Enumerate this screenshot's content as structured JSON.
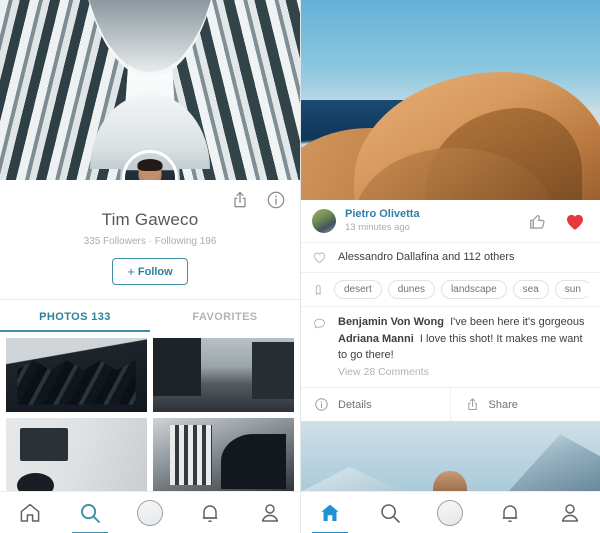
{
  "left": {
    "cover_image_alt": "curved-striped-building-cover",
    "avatar_alt": "user-avatar",
    "share_icon": "share-icon",
    "info_icon": "info-icon",
    "username": "Tim Gaweco",
    "stats": "335 Followers · Following 196",
    "follow_label": "Follow",
    "follow_plus": "+",
    "tabs": [
      {
        "label": "PHOTOS 133",
        "active": true
      },
      {
        "label": "FAVORITES",
        "active": false
      }
    ],
    "photos": [
      {
        "alt": "dark-geometric-architecture"
      },
      {
        "alt": "city-street-with-tower"
      },
      {
        "alt": "overhead-street-white"
      },
      {
        "alt": "spiral-parking-ramp"
      }
    ],
    "nav": [
      {
        "icon": "home-icon",
        "active": false
      },
      {
        "icon": "search-icon",
        "active": true
      },
      {
        "icon": "camera-circle-icon",
        "active": false
      },
      {
        "icon": "bell-icon",
        "active": false
      },
      {
        "icon": "profile-icon",
        "active": false
      }
    ]
  },
  "right": {
    "hero_alt": "desert-dunes-meeting-ocean",
    "post": {
      "avatar_alt": "pietro-olivetta-avatar",
      "user": "Pietro Olivetta",
      "time": "13 minutes ago",
      "thumb_icon": "thumbs-up-icon",
      "heart_icon": "heart-filled-icon",
      "likes_icon": "heart-outline-icon",
      "likes": "Alessandro Dallafina and 112 others",
      "tag_icon": "tag-icon",
      "tags": [
        "desert",
        "dunes",
        "landscape",
        "sea",
        "sun"
      ],
      "comment_icon": "comment-bubble-icon",
      "comments": [
        {
          "name": "Benjamin Von Wong",
          "text": "I've been here it's gorgeous"
        },
        {
          "name": "Adriana Manni",
          "text": "I love this shot! It makes me want to go there!"
        }
      ],
      "view_comments": "View 28 Comments",
      "details_label": "Details",
      "details_icon": "info-icon",
      "share_label": "Share",
      "share_icon": "share-icon"
    },
    "hero2_alt": "snowy-mountains-with-person",
    "nav": [
      {
        "icon": "home-icon",
        "active": true
      },
      {
        "icon": "search-icon",
        "active": false
      },
      {
        "icon": "camera-circle-icon",
        "active": false
      },
      {
        "icon": "bell-icon",
        "active": false
      },
      {
        "icon": "profile-icon",
        "active": false
      }
    ]
  },
  "colors": {
    "accent_teal": "#3d8ea8",
    "accent_blue": "#1f93d1",
    "heart_red": "#e8383d",
    "text_dark": "#3c4145",
    "text_muted": "#a9adb1"
  }
}
